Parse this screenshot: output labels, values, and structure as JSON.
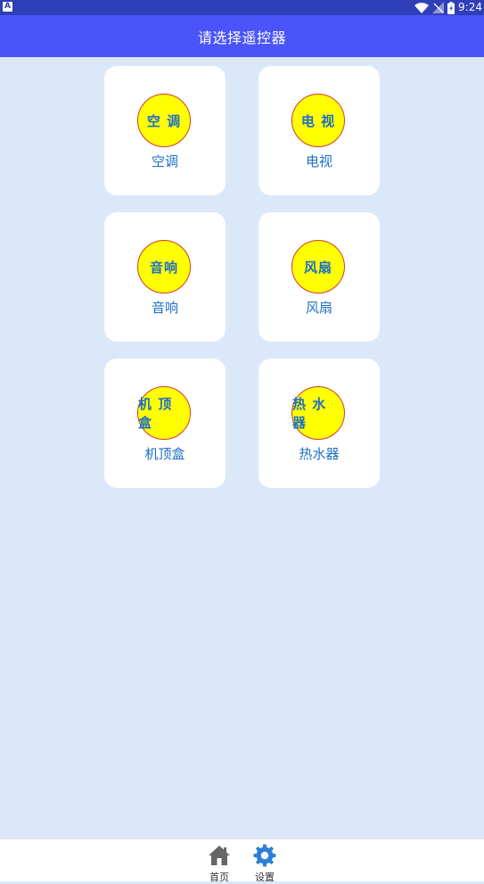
{
  "status_bar": {
    "left_icon": "A",
    "time": "9:24",
    "icons": [
      "wifi-icon",
      "signal-off-icon",
      "battery-icon"
    ]
  },
  "header": {
    "title": "请选择遥控器"
  },
  "devices": [
    {
      "badge": "空 调",
      "label": "空调"
    },
    {
      "badge": "电 视",
      "label": "电视"
    },
    {
      "badge": "音响",
      "label": "音响"
    },
    {
      "badge": "风扇",
      "label": "风扇"
    },
    {
      "badge": "机 顶 盒",
      "label": "机顶盒"
    },
    {
      "badge": "热 水 器",
      "label": "热水器"
    }
  ],
  "bottom_nav": {
    "items": [
      {
        "label": "首页",
        "icon": "home-icon"
      },
      {
        "label": "设置",
        "icon": "gear-icon",
        "active": true
      }
    ]
  },
  "colors": {
    "header_bg": "#4a54fa",
    "status_bg": "#2e3fb8",
    "page_bg": "#dbe8fa",
    "badge_fill": "#ffff00",
    "badge_border": "#d33a2a",
    "text_accent": "#1d6fc7",
    "active_icon": "#2b7fd9"
  }
}
